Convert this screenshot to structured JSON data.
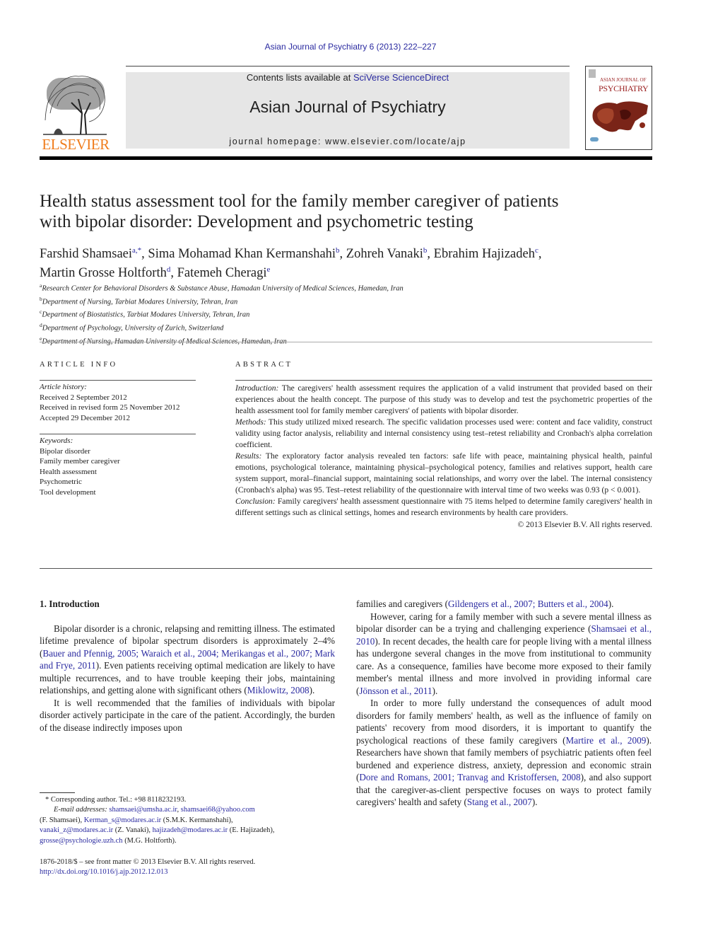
{
  "header": {
    "citation": "Asian Journal of Psychiatry 6 (2013) 222–227",
    "contents_prefix": "Contents lists available at ",
    "contents_link": "SciVerse ScienceDirect",
    "journal_name": "Asian Journal of Psychiatry",
    "homepage": "journal homepage: www.elsevier.com/locate/ajp",
    "publisher_logo_text": "ELSEVIER",
    "cover_line1": "ASIAN JOURNAL OF",
    "cover_line2": "PSYCHIATRY",
    "colors": {
      "publisher_orange": "#f07d1d",
      "link_blue": "#2a2aa0",
      "masthead_gray": "#e6e6e6"
    }
  },
  "article": {
    "title_line1": "Health status assessment tool for the family member caregiver of patients",
    "title_line2": "with bipolar disorder: Development and psychometric testing",
    "authors": [
      {
        "name": "Farshid Shamsaei",
        "sup": "a,*",
        "sep": ", "
      },
      {
        "name": "Sima Mohamad Khan Kermanshahi",
        "sup": "b",
        "sep": ", "
      },
      {
        "name": "Zohreh Vanaki",
        "sup": "b",
        "sep": ", "
      },
      {
        "name": "Ebrahim Hajizadeh",
        "sup": "c",
        "sep": ","
      },
      {
        "name": "Martin Grosse Holtforth",
        "sup": "d",
        "sep": ", "
      },
      {
        "name": "Fatemeh Cheragi",
        "sup": "e",
        "sep": ""
      }
    ],
    "affiliations": [
      {
        "key": "a",
        "text": "Research Center for Behavioral Disorders & Substance Abuse, Hamadan University of Medical Sciences, Hamedan, Iran"
      },
      {
        "key": "b",
        "text": "Department of Nursing, Tarbiat Modares University, Tehran, Iran"
      },
      {
        "key": "c",
        "text": "Department of Biostatistics, Tarbiat Modares University, Tehran, Iran"
      },
      {
        "key": "d",
        "text": "Department of Psychology, University of Zurich, Switzerland"
      },
      {
        "key": "e",
        "text": "Department of Nursing, Hamadan University of Medical Sciences, Hamedan, Iran"
      }
    ]
  },
  "article_info": {
    "heading": "ARTICLE INFO",
    "history_label": "Article history:",
    "history": [
      "Received 2 September 2012",
      "Received in revised form 25 November 2012",
      "Accepted 29 December 2012"
    ],
    "keywords_label": "Keywords:",
    "keywords": [
      "Bipolar disorder",
      "Family member caregiver",
      "Health assessment",
      "Psychometric",
      "Tool development"
    ]
  },
  "abstract": {
    "heading": "ABSTRACT",
    "sections": [
      {
        "label": "Introduction:",
        "text": " The caregivers' health assessment requires the application of a valid instrument that provided based on their experiences about the health concept. The purpose of this study was to develop and test the psychometric properties of the health assessment tool for family member caregivers' of patients with bipolar disorder."
      },
      {
        "label": "Methods:",
        "text": " This study utilized mixed research. The specific validation processes used were: content and face validity, construct validity using factor analysis, reliability and internal consistency using test–retest reliability and Cronbach's alpha correlation coefficient."
      },
      {
        "label": "Results:",
        "text": " The exploratory factor analysis revealed ten factors: safe life with peace, maintaining physical health, painful emotions, psychological tolerance, maintaining physical–psychological potency, families and relatives support, health care system support, moral–financial support, maintaining social relationships, and worry over the label. The internal consistency (Cronbach's alpha) was 95. Test–retest reliability of the questionnaire with interval time of two weeks was 0.93 (p < 0.001)."
      },
      {
        "label": "Conclusion:",
        "text": " Family caregivers' health assessment questionnaire with 75 items helped to determine family caregivers' health in different settings such as clinical settings, homes and research environments by health care providers."
      }
    ],
    "copyright": "© 2013 Elsevier B.V. All rights reserved."
  },
  "body": {
    "section_heading": "1.  Introduction",
    "left_col": {
      "p1_a": "Bipolar disorder is a chronic, relapsing and remitting illness. The estimated lifetime prevalence of bipolar spectrum disorders is approximately 2–4% (",
      "p1_cite1": "Bauer and Pfennig, 2005; Waraich et al., 2004; Merikangas et al., 2007; Mark and Frye, 2011",
      "p1_b": "). Even patients receiving optimal medication are likely to have multiple recurrences, and to have trouble keeping their jobs, maintaining relationships, and getting alone with significant others (",
      "p1_cite2": "Miklowitz, 2008",
      "p1_c": ").",
      "p2": "It is well recommended that the families of individuals with bipolar disorder actively participate in the care of the patient. Accordingly, the burden of the disease indirectly imposes upon"
    },
    "right_col": {
      "p0_a": "families and caregivers (",
      "p0_cite": "Gildengers et al., 2007; Butters et al., 2004",
      "p0_b": ").",
      "p1_a": "However, caring for a family member with such a severe mental illness as bipolar disorder can be a trying and challenging experience (",
      "p1_cite1": "Shamsaei et al., 2010",
      "p1_b": "). In recent decades, the health care for people living with a mental illness has undergone several changes in the move from institutional to community care. As a consequence, families have become more exposed to their family member's mental illness and more involved in providing informal care (",
      "p1_cite2": "Jönsson et al., 2011",
      "p1_c": ").",
      "p2_a": "In order to more fully understand the consequences of adult mood disorders for family members' health, as well as the influence of family on patients' recovery from mood disorders, it is important to quantify the psychological reactions of these family caregivers (",
      "p2_cite1": "Martire et al., 2009",
      "p2_b": "). Researchers have shown that family members of psychiatric patients often feel burdened and experience distress, anxiety, depression and economic strain (",
      "p2_cite2": "Dore and Romans, 2001; Tranvag and Kristoffersen, 2008",
      "p2_c": "), and also support that the caregiver-as-client perspective focuses on ways to protect family caregivers' health and safety (",
      "p2_cite3": "Stang et al., 2007",
      "p2_d": ")."
    }
  },
  "footnotes": {
    "corresponding": "* Corresponding author. Tel.: +98 8118232193.",
    "email_label": "E-mail addresses:",
    "email1": "shamsaei@umsha.ac.ir",
    "email2": "shamsaei68@yahoo.com",
    "email2_owner": "(F. Shamsaei),",
    "email3": "Kerman_s@modares.ac.ir",
    "email3_owner": "(S.M.K. Kermanshahi),",
    "email4": "vanaki_z@modares.ac.ir",
    "email4_owner": "(Z. Vanaki),",
    "email5": "hajizadeh@modares.ac.ir",
    "email5_owner": "(E. Hajizadeh),",
    "email6": "grosse@psychologie.uzh.ch",
    "email6_owner": "(M.G. Holtforth).",
    "issn_line": "1876-2018/$ – see front matter © 2013 Elsevier B.V. All rights reserved.",
    "doi": "http://dx.doi.org/10.1016/j.ajp.2012.12.013"
  }
}
